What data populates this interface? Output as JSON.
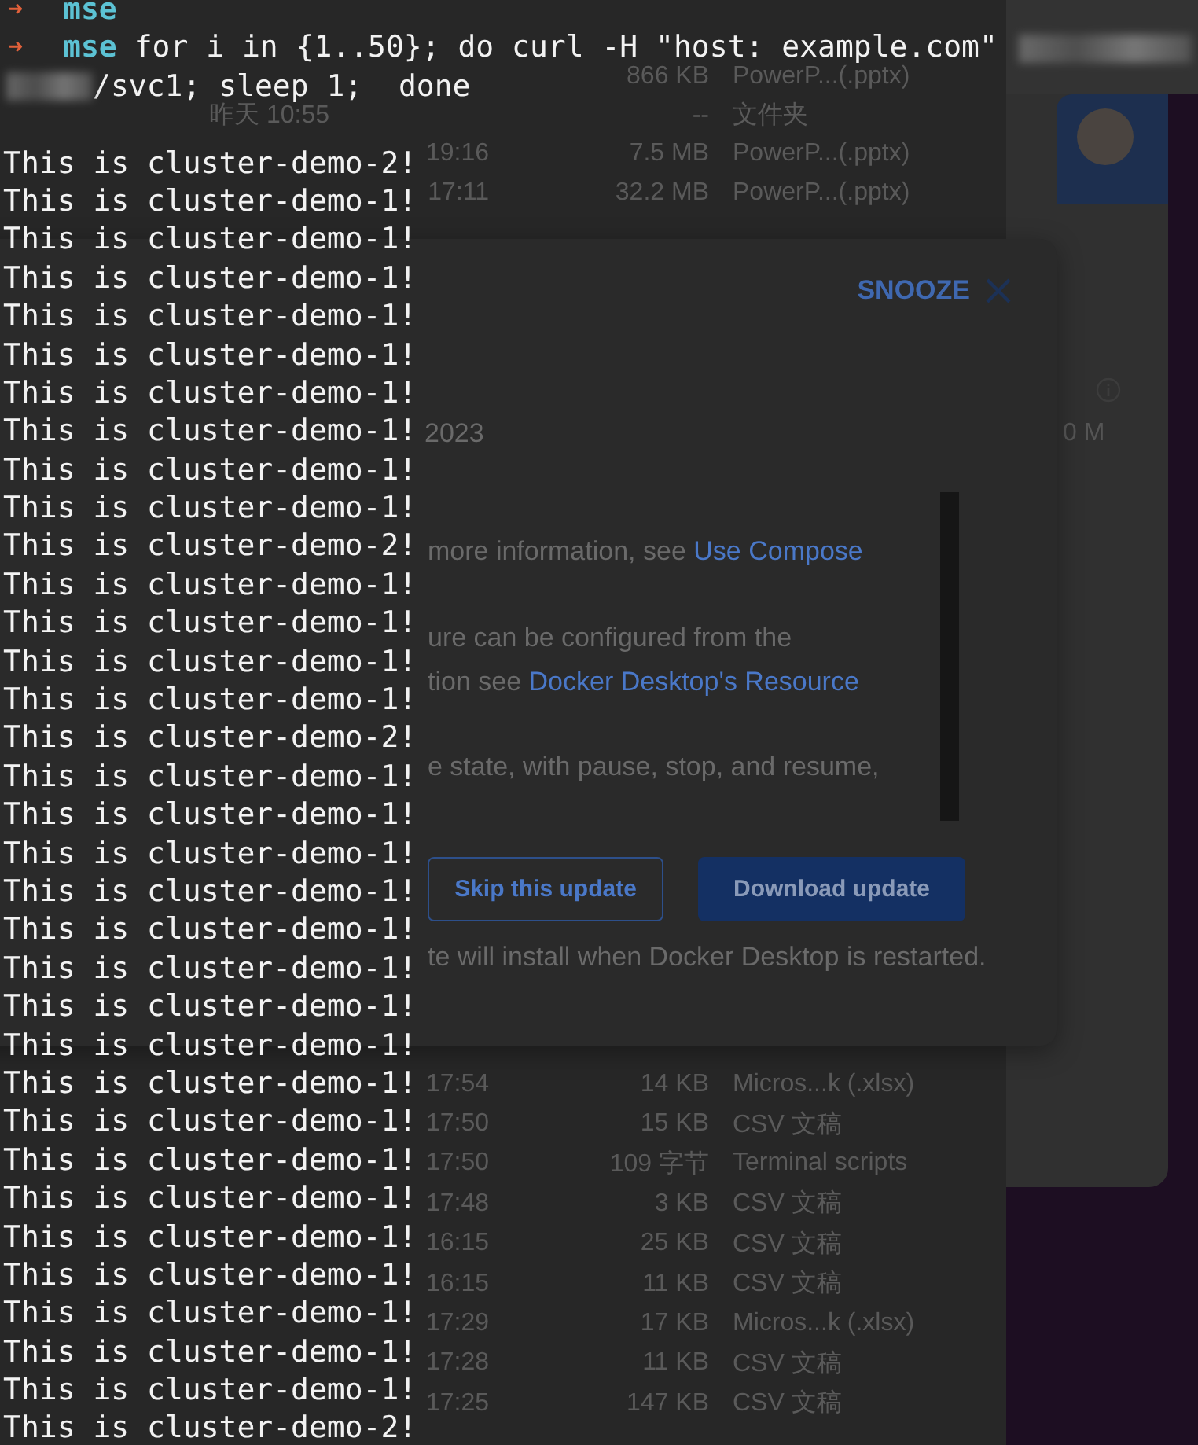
{
  "terminal": {
    "prompts": [
      {
        "arrow": "➜",
        "user": "mse"
      },
      {
        "arrow": "➜",
        "user": "mse",
        "command": "for i in {1..50}; do curl -H \"host: example.com\""
      }
    ],
    "continuation": "/svc1; sleep 1;  done",
    "output": [
      "This is cluster-demo-2!",
      "This is cluster-demo-1!",
      "This is cluster-demo-1!",
      "This is cluster-demo-1!",
      "This is cluster-demo-1!",
      "This is cluster-demo-1!",
      "This is cluster-demo-1!",
      "This is cluster-demo-1!",
      "This is cluster-demo-1!",
      "This is cluster-demo-1!",
      "This is cluster-demo-2!",
      "This is cluster-demo-1!",
      "This is cluster-demo-1!",
      "This is cluster-demo-1!",
      "This is cluster-demo-1!",
      "This is cluster-demo-2!",
      "This is cluster-demo-1!",
      "This is cluster-demo-1!",
      "This is cluster-demo-1!",
      "This is cluster-demo-1!",
      "This is cluster-demo-1!",
      "This is cluster-demo-1!",
      "This is cluster-demo-1!",
      "This is cluster-demo-1!",
      "This is cluster-demo-1!",
      "This is cluster-demo-1!",
      "This is cluster-demo-1!",
      "This is cluster-demo-1!",
      "This is cluster-demo-1!",
      "This is cluster-demo-1!",
      "This is cluster-demo-1!",
      "This is cluster-demo-1!",
      "This is cluster-demo-1!",
      "This is cluster-demo-2!"
    ]
  },
  "file_list": {
    "top_rows": [
      {
        "size": "866 KB",
        "kind": "PowerP...(.pptx)"
      },
      {
        "date": "昨天 10:55",
        "size": "--",
        "kind": "文件夹"
      },
      {
        "time": "19:16",
        "size": "7.5 MB",
        "kind": "PowerP...(.pptx)"
      },
      {
        "time": "17:11",
        "size": "32.2 MB",
        "kind": "PowerP...(.pptx)"
      }
    ],
    "bottom_rows": [
      {
        "time": "17:54",
        "size": "14 KB",
        "kind": "Micros...k (.xlsx)"
      },
      {
        "time": "17:50",
        "size": "15 KB",
        "kind": "CSV 文稿"
      },
      {
        "time": "17:50",
        "size": "109 字节",
        "kind": "Terminal scripts"
      },
      {
        "time": "17:48",
        "size": "3 KB",
        "kind": "CSV 文稿"
      },
      {
        "time": "16:15",
        "size": "25 KB",
        "kind": "CSV 文稿"
      },
      {
        "time": "16:15",
        "size": "11 KB",
        "kind": "CSV 文稿"
      },
      {
        "time": "17:29",
        "size": "17 KB",
        "kind": "Micros...k (.xlsx)"
      },
      {
        "time": "17:28",
        "size": "11 KB",
        "kind": "CSV 文稿"
      },
      {
        "time": "17:25",
        "size": "147 KB",
        "kind": "CSV 文稿"
      }
    ]
  },
  "update_dialog": {
    "snooze": "SNOOZE",
    "date": "2023",
    "paragraphs": [
      {
        "lines": [
          {
            "text": "more information, see ",
            "link": "Use Compose"
          }
        ]
      },
      {
        "lines": [
          {
            "text": "ure can be configured from the"
          },
          {
            "text": "tion see ",
            "link": "Docker Desktop's Resource"
          }
        ]
      },
      {
        "lines": [
          {
            "text": "e state, with pause, stop, and resume,"
          }
        ]
      }
    ],
    "buttons": [
      {
        "label": "Skip this update",
        "kind": "secondary"
      },
      {
        "label": "Download update",
        "kind": "primary"
      }
    ],
    "footer": "te will install when Docker Desktop is restarted."
  },
  "side_panel": {
    "reading": "0 M"
  }
}
